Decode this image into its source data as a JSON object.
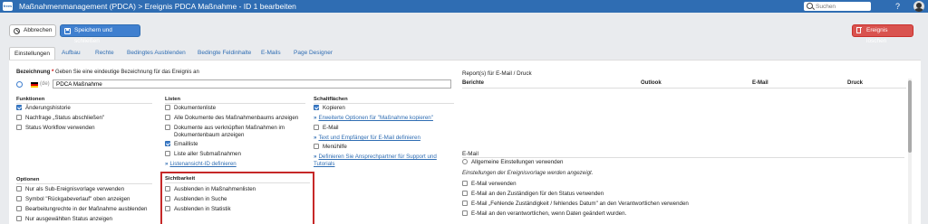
{
  "app": {
    "logo_text": "frees",
    "title": "Maßnahmenmanagement (PDCA) > Ereignis PDCA Maßnahme - ID 1 bearbeiten",
    "search_placeholder": "Suchen",
    "help_label": "?"
  },
  "toolbar": {
    "cancel_label": "Abbrechen",
    "save_label": "Speichern und schließen",
    "close_event_label": "Ereignis löschen"
  },
  "tabs": [
    {
      "label": "Einstellungen",
      "active": true
    },
    {
      "label": "Aufbau"
    },
    {
      "label": "Rechte"
    },
    {
      "label": "Bedingtes Ausblenden"
    },
    {
      "label": "Bedingte Feldinhalte"
    },
    {
      "label": "E-Mails"
    },
    {
      "label": "Page Designer"
    }
  ],
  "bezeichnung": {
    "label": "Bezeichnung",
    "required_mark": "*",
    "hint": "Geben Sie eine eindeutige Bezeichnung für das Ereignis an",
    "lang": "(de)",
    "value": "PDCA Maßnahme"
  },
  "reports": {
    "title": "Report(s) für E-Mail / Druck",
    "columns": [
      "Berichte",
      "Outlook",
      "E-Mail",
      "Druck"
    ]
  },
  "funktionen": {
    "title": "Funktionen",
    "items": [
      {
        "label": "Änderungshistorie",
        "checked": true
      },
      {
        "label": "Nachfrage „Status abschließen\"",
        "checked": false
      },
      {
        "label": "Status Workflow verwenden",
        "checked": false
      }
    ]
  },
  "listen": {
    "title": "Listen",
    "items": [
      {
        "label": "Dokumentenliste",
        "checked": false
      },
      {
        "label": "Alle Dokumente des Maßnahmenbaums anzeigen",
        "checked": false
      },
      {
        "label": "Dokumente aus verknüpften Maßnahmen im",
        "label2": "Dokumentenbaum anzeigen",
        "checked": false
      },
      {
        "label": "Emailliste",
        "checked": true
      },
      {
        "label": "Liste aller Submaßnahmen",
        "checked": false
      }
    ],
    "link": "Listenansicht-ID definieren"
  },
  "schaltflaechen": {
    "title": "Schaltflächen",
    "kopieren": "Kopieren",
    "link_kopieren": "Erweiterte Optionen für \"Maßnahme kopieren\"",
    "email": "E-Mail",
    "link_email": "Text und Empfänger für E-Mail definieren",
    "menuehilfe": "Menühilfe",
    "link_support": "Definieren Sie Ansprechpartner für Support und",
    "link_support2": "Tutorials"
  },
  "optionen": {
    "title": "Optionen",
    "items": [
      "Nur als Sub-Ereignisvorlage verwenden",
      "Symbol \"Rückgabeverlauf\" oben anzeigen",
      "Bearbeitungrechte in der Maßnahme ausblenden",
      "Nur ausgewählten Status anzeigen"
    ]
  },
  "sichtbarkeit": {
    "title": "Sichtbarkeit",
    "items": [
      "Ausblenden in Maßnahmenlisten",
      "Ausblenden in Suche",
      "Ausblenden in Statistik"
    ]
  },
  "email": {
    "title": "E-Mail",
    "radio_label": "Allgemeine Einstellungen verwenden",
    "note": "Einstellungen der Ereignisvorlage werden angezeigt.",
    "items": [
      "E-Mail verwenden",
      "E-Mail an den Zuständigen für den Status verwenden",
      "E-Mail „Fehlende Zuständigkeit / fehlendes Datum\" an den Verantwortlichen verwenden",
      "E-Mail an den verantwortlichen, wenn Daten geändert wurden."
    ]
  },
  "colors": {
    "brand": "#2f6db3",
    "danger": "#d9534f",
    "highlight": "#c62828"
  }
}
